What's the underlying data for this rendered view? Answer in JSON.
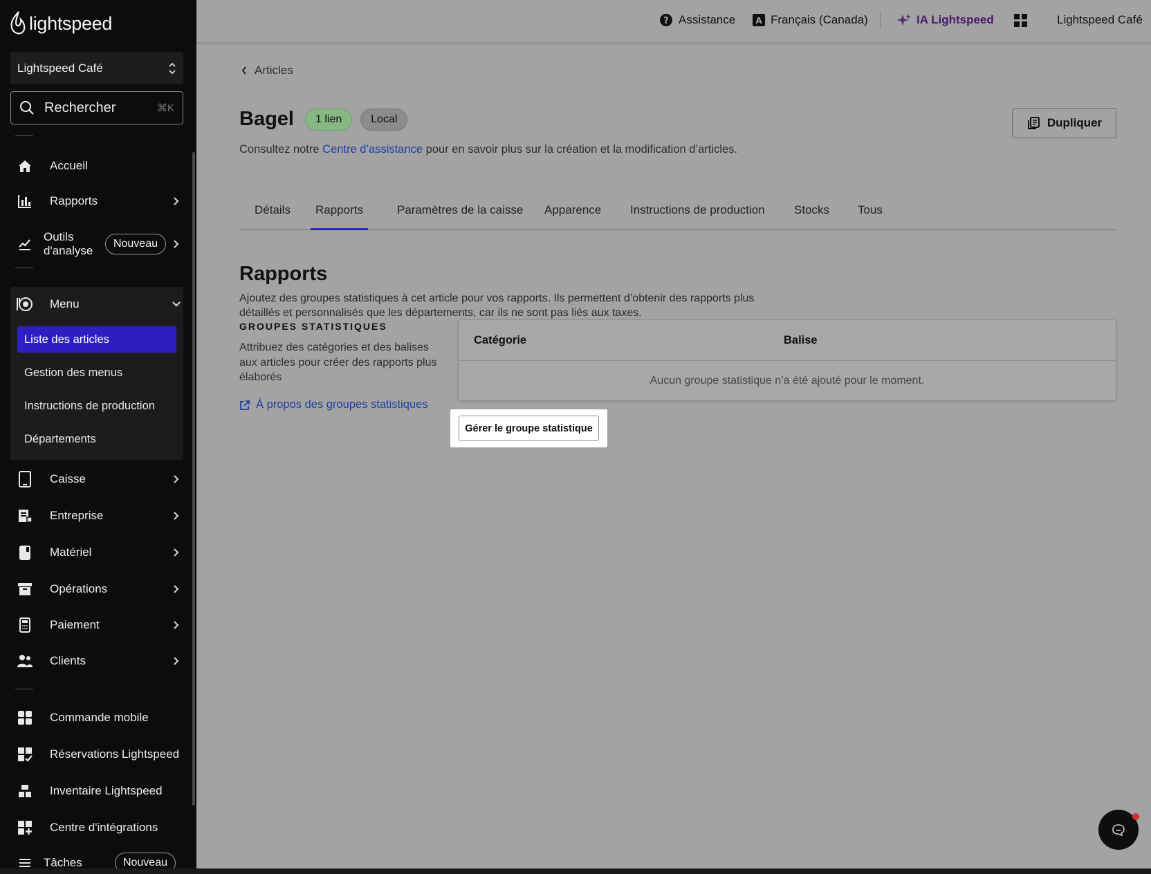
{
  "app": {
    "brand": "lightspeed"
  },
  "sidebar": {
    "store": "Lightspeed Café",
    "search": {
      "placeholder": "Rechercher",
      "shortcut": "⌘K"
    },
    "items": [
      {
        "label": "Accueil",
        "icon": "home-icon"
      },
      {
        "label": "Rapports",
        "icon": "bar-chart-icon"
      },
      {
        "label": "Outils d'analyse",
        "label_line1": "Outils",
        "label_line2": "d'analyse",
        "badge": "Nouveau",
        "icon": "analytics-icon"
      },
      {
        "label": "Menu",
        "icon": "menu-food-icon"
      },
      {
        "label": "Caisse",
        "icon": "tablet-icon"
      },
      {
        "label": "Entreprise",
        "icon": "business-icon"
      },
      {
        "label": "Matériel",
        "icon": "hardware-icon"
      },
      {
        "label": "Opérations",
        "icon": "archive-icon"
      },
      {
        "label": "Paiement",
        "icon": "payment-terminal-icon"
      },
      {
        "label": "Clients",
        "icon": "people-icon"
      },
      {
        "label": "Commande mobile",
        "icon": "mobile-order-icon"
      },
      {
        "label": "Réservations Lightspeed",
        "icon": "reservations-icon"
      },
      {
        "label": "Inventaire Lightspeed",
        "icon": "inventory-icon"
      },
      {
        "label": "Centre d'intégrations",
        "icon": "integrations-icon"
      },
      {
        "label": "Tâches",
        "badge": "Nouveau",
        "icon": "tasks-icon"
      }
    ],
    "menu_sub": [
      {
        "label": "Liste des articles",
        "active": true
      },
      {
        "label": "Gestion des menus"
      },
      {
        "label": "Instructions de production"
      },
      {
        "label": "Départements"
      }
    ]
  },
  "topbar": {
    "assistance": "Assistance",
    "language": "Français (Canada)",
    "ai": "IA Lightspeed",
    "account": "Lightspeed Café"
  },
  "main": {
    "breadcrumb": "Articles",
    "title": "Bagel",
    "pill_link": "1 lien",
    "pill_local": "Local",
    "duplicate": "Dupliquer",
    "subtitle_pre": "Consultez notre ",
    "subtitle_link": "Centre d’assistance",
    "subtitle_post": " pour en savoir plus sur la création et la modification d’articles.",
    "tabs": [
      "Détails",
      "Rapports",
      "Paramètres de la caisse",
      "Apparence",
      "Instructions de production",
      "Stocks",
      "Tous"
    ],
    "active_tab": "Rapports",
    "section_title": "Rapports",
    "section_desc": "Ajoutez des groupes statistiques à cet article pour vos rapports. Ils permettent d’obtenir des rapports plus détaillés et personnalisés que les départements, car ils ne sont pas liés aux taxes.",
    "group_title": "GROUPES STATISTIQUES",
    "group_desc": "Attribuez des catégories et des balises aux articles pour créer des rapports plus élaborés",
    "group_link": "À propos des groupes statistiques",
    "table": {
      "headers": [
        "Catégorie",
        "Balise"
      ],
      "empty": "Aucun groupe statistique n’a été ajouté pour le moment."
    },
    "manage_button": "Gérer le groupe statistique"
  },
  "colors": {
    "active_nav": "#2e1fc2",
    "link": "#1f3fa0",
    "ai": "#4a1a6a",
    "pill_green": "#87b884"
  }
}
